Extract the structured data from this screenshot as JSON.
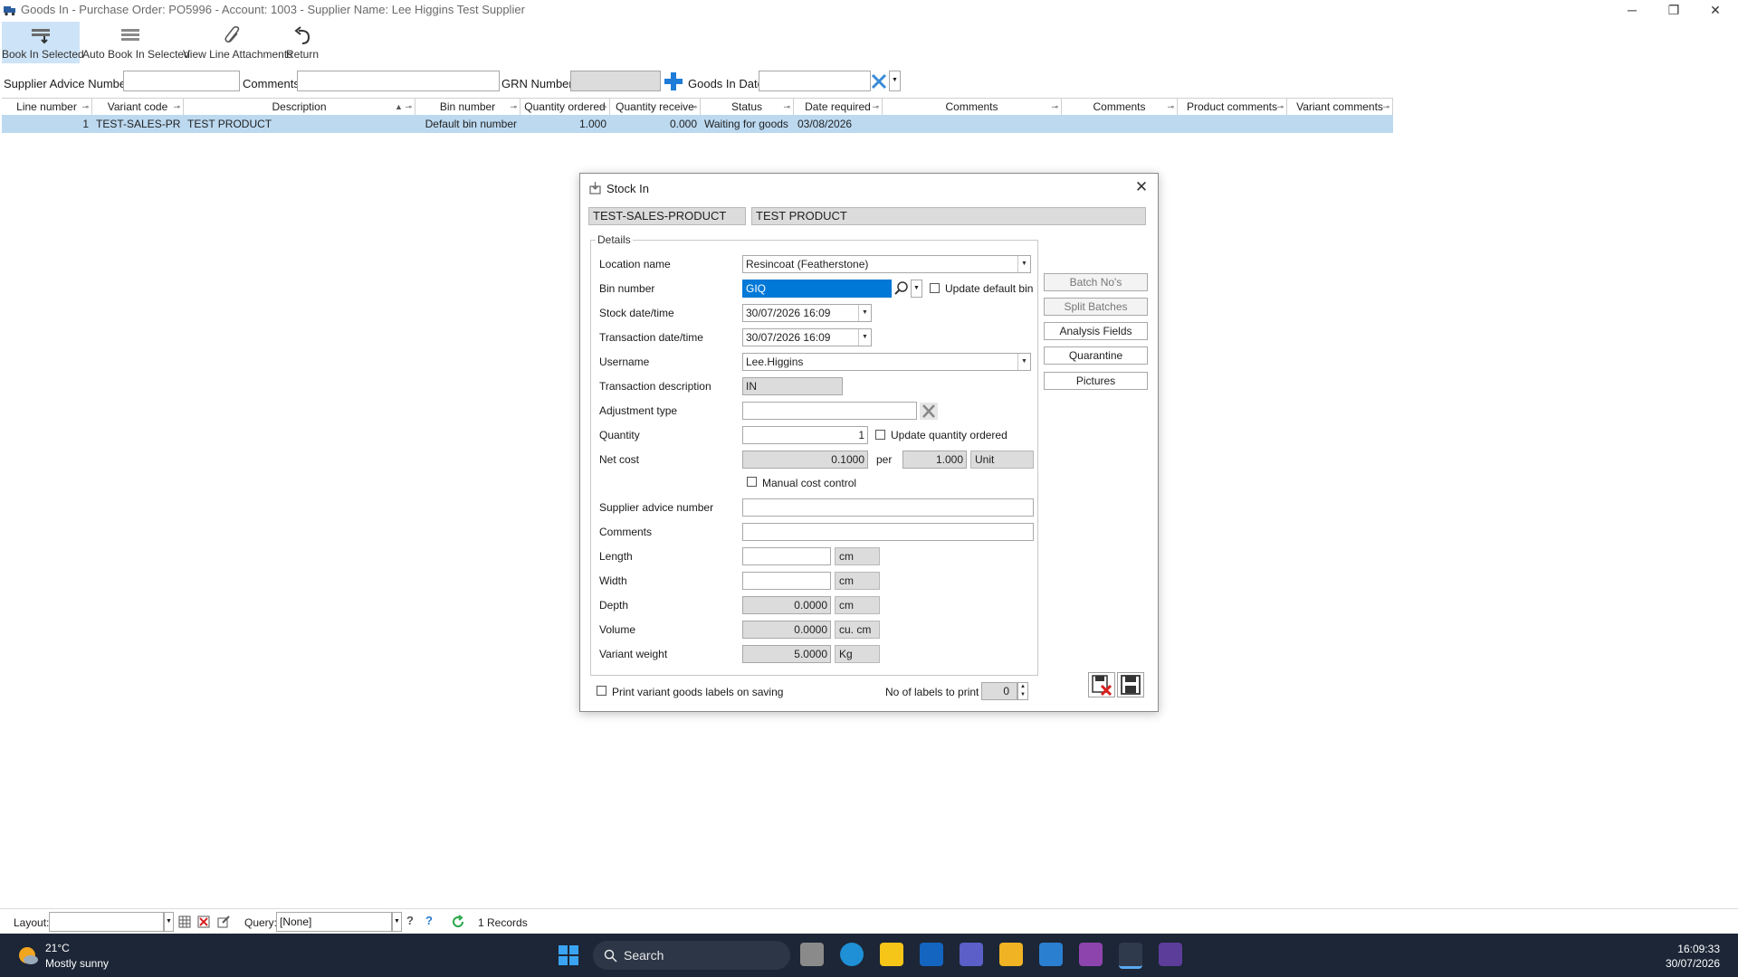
{
  "window": {
    "title": "Goods In - Purchase Order: PO5996 - Account: 1003 - Supplier Name: Lee Higgins Test Supplier",
    "minimize": "─",
    "restore": "❐",
    "close": "✕"
  },
  "toolbar": {
    "book_in_selected": "Book In Selected",
    "auto_book_in_selected": "Auto Book In Selected",
    "view_line_attachments": "View Line Attachments",
    "return": "Return"
  },
  "filters": {
    "supplier_advice_number_label": "Supplier Advice Number",
    "supplier_advice_number_value": "",
    "comments_label": "Comments",
    "comments_value": "",
    "grn_number_label": "GRN Number",
    "grn_number_value": "",
    "goods_in_date_label": "Goods In Date",
    "goods_in_date_value": ""
  },
  "grid": {
    "columns": [
      "Line number",
      "Variant code",
      "Description",
      "Bin number",
      "Quantity ordered",
      "Quantity receive",
      "Status",
      "Date required",
      "Comments",
      "Comments",
      "Product comments",
      "Variant comments"
    ],
    "rows": [
      {
        "line_number": "1",
        "variant_code": "TEST-SALES-PR",
        "description": "TEST PRODUCT",
        "bin_number": "Default bin number",
        "quantity_ordered": "1.000",
        "quantity_received": "0.000",
        "status": "Waiting for goods",
        "date_required": "03/08/2026",
        "comments1": "",
        "comments2": "",
        "product_comments": "",
        "variant_comments": ""
      }
    ]
  },
  "dialog": {
    "title": "Stock In",
    "product_code": "TEST-SALES-PRODUCT",
    "product_name": "TEST PRODUCT",
    "details_group": "Details",
    "location_name_label": "Location name",
    "location_name_value": "Resincoat (Featherstone)",
    "bin_number_label": "Bin number",
    "bin_number_value": "GIQ",
    "update_default_bin_label": "Update default bin",
    "stock_datetime_label": "Stock date/time",
    "stock_datetime_value": "30/07/2026 16:09",
    "transaction_datetime_label": "Transaction date/time",
    "transaction_datetime_value": "30/07/2026 16:09",
    "username_label": "Username",
    "username_value": "Lee.Higgins",
    "transaction_description_label": "Transaction description",
    "transaction_description_value": "IN",
    "adjustment_type_label": "Adjustment type",
    "adjustment_type_value": "",
    "quantity_label": "Quantity",
    "quantity_value": "1",
    "update_quantity_ordered_label": "Update quantity ordered",
    "net_cost_label": "Net cost",
    "net_cost_value": "0.1000",
    "per_label": "per",
    "per_value": "1.000",
    "per_unit": "Unit",
    "manual_cost_control_label": "Manual cost control",
    "supplier_advice_number_label": "Supplier advice number",
    "supplier_advice_number_value": "",
    "comments_label": "Comments",
    "comments_value": "",
    "length_label": "Length",
    "length_value": "",
    "length_unit": "cm",
    "width_label": "Width",
    "width_value": "",
    "width_unit": "cm",
    "depth_label": "Depth",
    "depth_value": "0.0000",
    "depth_unit": "cm",
    "volume_label": "Volume",
    "volume_value": "0.0000",
    "volume_unit": "cu. cm",
    "variant_weight_label": "Variant weight",
    "variant_weight_value": "5.0000",
    "variant_weight_unit": "Kg",
    "batch_nos_button": "Batch No's",
    "split_batches_button": "Split Batches",
    "analysis_fields_button": "Analysis Fields",
    "quarantine_button": "Quarantine",
    "pictures_button": "Pictures",
    "print_labels_label": "Print variant goods labels on saving",
    "no_of_labels_label": "No of labels to print",
    "no_of_labels_value": "0"
  },
  "statusbar": {
    "layout_label": "Layout:",
    "layout_value": "",
    "query_label": "Query:",
    "query_value": "[None]",
    "records": "1 Records"
  },
  "taskbar": {
    "temperature": "21°C",
    "weather": "Mostly sunny",
    "search_label": "Search",
    "time": "16:09:33",
    "date": "30/07/2026"
  },
  "colors": {
    "selected_row": "#bcd9f0",
    "toolbar_active": "#cde3f7",
    "bin_highlight": "#0078d7",
    "taskbar": "#1c2636"
  }
}
